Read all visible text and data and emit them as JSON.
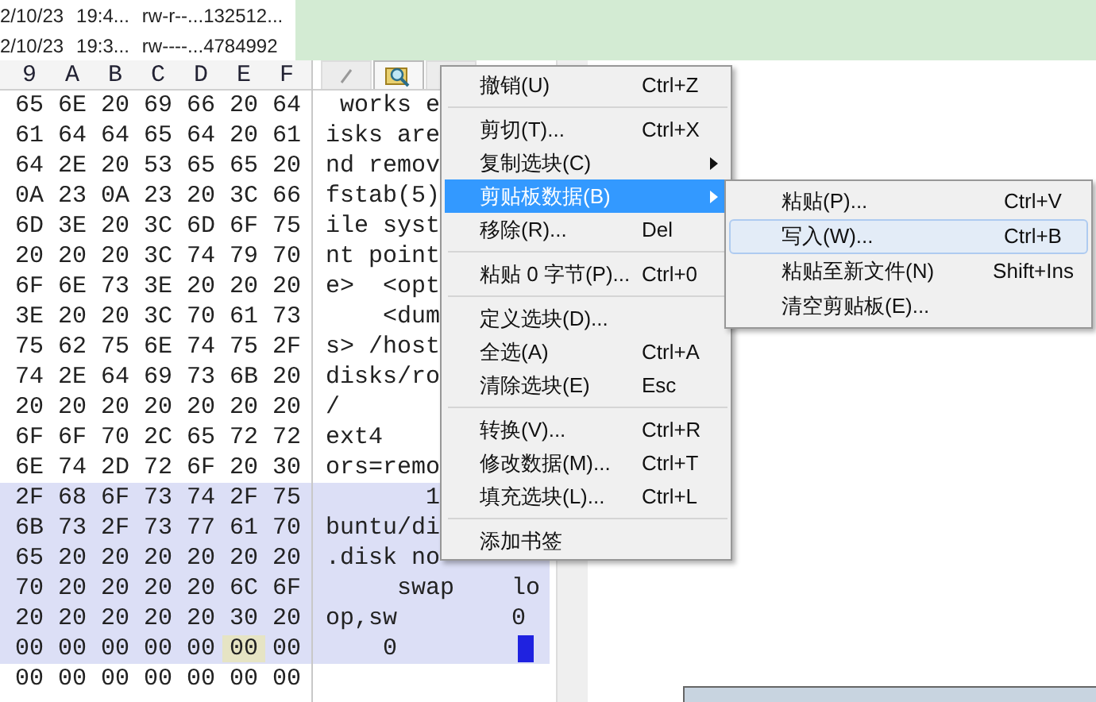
{
  "file_list": [
    {
      "date": "2/10/23",
      "time": "19:4...",
      "attributes": "rw-r--...",
      "size": "132512..."
    },
    {
      "date": "2/10/23",
      "time": "19:3...",
      "attributes": "rw----...",
      "size": "4784992"
    }
  ],
  "hex_view": {
    "columns": [
      "9",
      "A",
      "B",
      "C",
      "D",
      "E",
      "F"
    ],
    "rows": [
      {
        "cells": [
          "65",
          "6E",
          "20",
          "69",
          "66",
          "20",
          "64"
        ],
        "text": " works e",
        "selected": false
      },
      {
        "cells": [
          "61",
          "64",
          "64",
          "65",
          "64",
          "20",
          "61"
        ],
        "text": "isks are",
        "selected": false
      },
      {
        "cells": [
          "64",
          "2E",
          "20",
          "53",
          "65",
          "65",
          "20"
        ],
        "text": "nd remov",
        "selected": false
      },
      {
        "cells": [
          "0A",
          "23",
          "0A",
          "23",
          "20",
          "3C",
          "66"
        ],
        "text": "fstab(5)",
        "selected": false
      },
      {
        "cells": [
          "6D",
          "3E",
          "20",
          "3C",
          "6D",
          "6F",
          "75"
        ],
        "text": "ile syst",
        "selected": false
      },
      {
        "cells": [
          "20",
          "20",
          "20",
          "3C",
          "74",
          "79",
          "70"
        ],
        "text": "nt point",
        "selected": false
      },
      {
        "cells": [
          "6F",
          "6E",
          "73",
          "3E",
          "20",
          "20",
          "20"
        ],
        "text": "e>  <opt",
        "selected": false
      },
      {
        "cells": [
          "3E",
          "20",
          "20",
          "3C",
          "70",
          "61",
          "73"
        ],
        "text": "    <dum",
        "selected": false
      },
      {
        "cells": [
          "75",
          "62",
          "75",
          "6E",
          "74",
          "75",
          "2F"
        ],
        "text": "s> /host",
        "selected": false
      },
      {
        "cells": [
          "74",
          "2E",
          "64",
          "69",
          "73",
          "6B",
          "20"
        ],
        "text": "disks/ro",
        "selected": false
      },
      {
        "cells": [
          "20",
          "20",
          "20",
          "20",
          "20",
          "20",
          "20"
        ],
        "text": "/",
        "selected": false
      },
      {
        "cells": [
          "6F",
          "6F",
          "70",
          "2C",
          "65",
          "72",
          "72"
        ],
        "text": "ext4",
        "selected": false
      },
      {
        "cells": [
          "6E",
          "74",
          "2D",
          "72",
          "6F",
          "20",
          "30"
        ],
        "text": "ors=remo",
        "selected": false
      },
      {
        "cells": [
          "2F",
          "68",
          "6F",
          "73",
          "74",
          "2F",
          "75"
        ],
        "text": "       1",
        "selected": true
      },
      {
        "cells": [
          "6B",
          "73",
          "2F",
          "73",
          "77",
          "61",
          "70"
        ],
        "text": "buntu/di",
        "selected": true
      },
      {
        "cells": [
          "65",
          "20",
          "20",
          "20",
          "20",
          "20",
          "20"
        ],
        "text": ".disk no",
        "selected": true
      },
      {
        "cells": [
          "70",
          "20",
          "20",
          "20",
          "20",
          "6C",
          "6F"
        ],
        "text": "     swap    lo",
        "selected": true
      },
      {
        "cells": [
          "20",
          "20",
          "20",
          "20",
          "20",
          "30",
          "20"
        ],
        "text": "op,sw        0",
        "selected": true
      },
      {
        "cells": [
          "00",
          "00",
          "00",
          "00",
          "00",
          "00",
          "00"
        ],
        "text": "    0",
        "selected": true,
        "cursor_cells": [
          false,
          false,
          false,
          false,
          false,
          true,
          false
        ],
        "text_cursor": true
      },
      {
        "cells": [
          "00",
          "00",
          "00",
          "00",
          "00",
          "00",
          "00"
        ],
        "text": "",
        "selected": false
      }
    ]
  },
  "text_toolbar": [
    {
      "selected": false
    },
    {
      "selected": true
    },
    {
      "selected": false
    }
  ],
  "context_menu": [
    {
      "kind": "item",
      "label": "撤销(U)",
      "shortcut": "Ctrl+Z",
      "submenu": false,
      "selected": false
    },
    {
      "kind": "separator"
    },
    {
      "kind": "item",
      "label": "剪切(T)...",
      "shortcut": "Ctrl+X",
      "submenu": false,
      "selected": false
    },
    {
      "kind": "item",
      "label": "复制选块(C)",
      "submenu": true,
      "selected": false
    },
    {
      "kind": "item",
      "label": "剪贴板数据(B)",
      "submenu": true,
      "selected": true
    },
    {
      "kind": "item",
      "label": "移除(R)...",
      "shortcut": "Del",
      "submenu": false,
      "selected": false
    },
    {
      "kind": "separator"
    },
    {
      "kind": "item",
      "label": "粘贴 0 字节(P)...",
      "shortcut": "Ctrl+0",
      "submenu": false,
      "selected": false
    },
    {
      "kind": "separator"
    },
    {
      "kind": "item",
      "label": "定义选块(D)...",
      "submenu": false,
      "selected": false
    },
    {
      "kind": "item",
      "label": "全选(A)",
      "shortcut": "Ctrl+A",
      "submenu": false,
      "selected": false
    },
    {
      "kind": "item",
      "label": "清除选块(E)",
      "shortcut": "Esc",
      "submenu": false,
      "selected": false
    },
    {
      "kind": "separator"
    },
    {
      "kind": "item",
      "label": "转换(V)...",
      "shortcut": "Ctrl+R",
      "submenu": false,
      "selected": false
    },
    {
      "kind": "item",
      "label": "修改数据(M)...",
      "shortcut": "Ctrl+T",
      "submenu": false,
      "selected": false
    },
    {
      "kind": "item",
      "label": "填充选块(L)...",
      "shortcut": "Ctrl+L",
      "submenu": false,
      "selected": false
    },
    {
      "kind": "separator"
    },
    {
      "kind": "item",
      "label": "添加书签",
      "submenu": false,
      "selected": false
    }
  ],
  "submenu": [
    {
      "label": "粘贴(P)...",
      "shortcut": "Ctrl+V",
      "selected": false
    },
    {
      "label": "写入(W)...",
      "shortcut": "Ctrl+B",
      "selected": true
    },
    {
      "label": "粘贴至新文件(N)",
      "shortcut": "Shift+Ins",
      "selected": false
    },
    {
      "label": "清空剪贴板(E)...",
      "selected": false
    }
  ]
}
